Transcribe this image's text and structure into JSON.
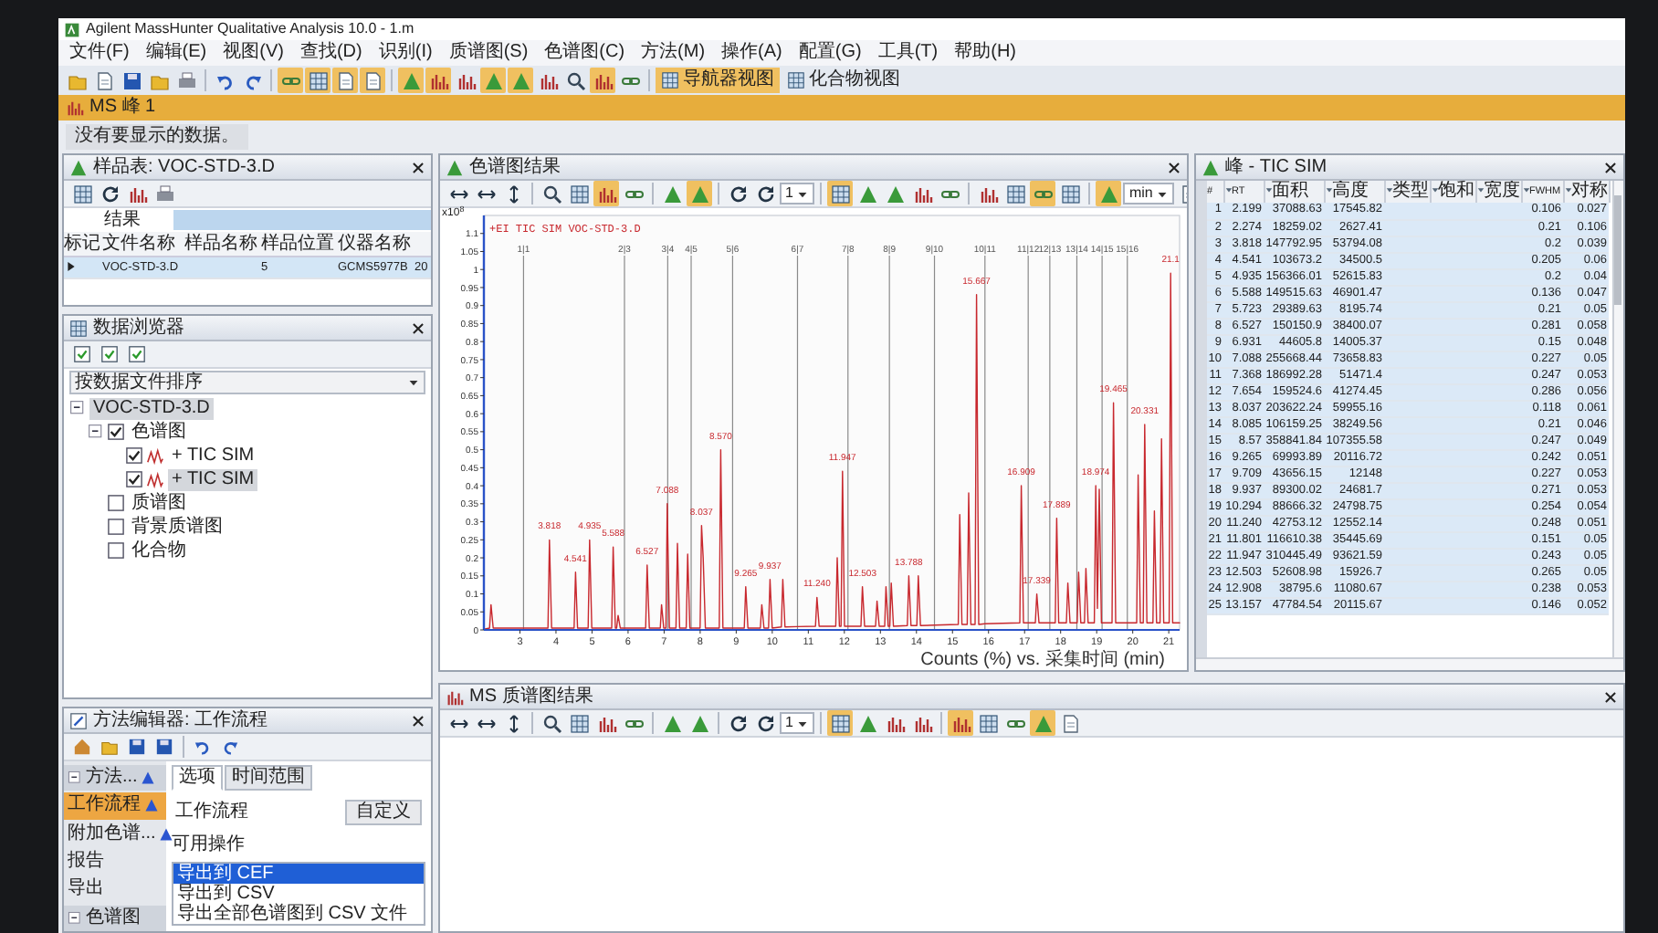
{
  "window": {
    "title": "Agilent MassHunter Qualitative Analysis 10.0 - 1.m"
  },
  "menu": [
    "文件(F)",
    "编辑(E)",
    "视图(V)",
    "查找(D)",
    "识别(I)",
    "质谱图(S)",
    "色谱图(C)",
    "方法(M)",
    "操作(A)",
    "配置(G)",
    "工具(T)",
    "帮助(H)"
  ],
  "toolbar": {
    "groups": [
      [
        {
          "kind": "folder",
          "pressed": false
        },
        {
          "kind": "doc",
          "pressed": false
        },
        {
          "kind": "save",
          "pressed": false
        },
        {
          "kind": "folder",
          "pressed": false
        },
        {
          "kind": "print",
          "pressed": false
        }
      ],
      [
        {
          "kind": "undo",
          "pressed": false
        },
        {
          "kind": "redo",
          "pressed": false
        }
      ],
      [
        {
          "kind": "link",
          "pressed": true
        },
        {
          "kind": "grid",
          "pressed": true
        },
        {
          "kind": "doc",
          "pressed": true
        },
        {
          "kind": "doc",
          "pressed": true
        }
      ],
      [
        {
          "kind": "peak",
          "pressed": true
        },
        {
          "kind": "bars",
          "pressed": true
        },
        {
          "kind": "bars",
          "pressed": false
        },
        {
          "kind": "peak",
          "pressed": true
        },
        {
          "kind": "peak",
          "pressed": true
        },
        {
          "kind": "bars",
          "pressed": false
        },
        {
          "kind": "zoom",
          "pressed": false
        },
        {
          "kind": "bars",
          "pressed": true
        },
        {
          "kind": "link",
          "pressed": false
        }
      ]
    ],
    "views": [
      {
        "label": "导航器视图",
        "selected": true
      },
      {
        "label": "化合物视图",
        "selected": false
      }
    ]
  },
  "document_tab": {
    "label": "MS 峰 1"
  },
  "notice": "没有要显示的数据。",
  "sample_table": {
    "title": "样品表: VOC-STD-3.D",
    "group": "结果",
    "columns": [
      "标记",
      "文件名称",
      "样品名称",
      "样品位置",
      "仪器名称"
    ],
    "rows": [
      {
        "cells": [
          null,
          "VOC-STD-3.D",
          null,
          "5",
          "GCMS5977B",
          "20"
        ],
        "selected": true
      }
    ]
  },
  "data_browser": {
    "title": "数据浏览器",
    "sort": "按数据文件排序",
    "tree": [
      {
        "label": "VOC-STD-3.D",
        "expanded": true,
        "selected": true,
        "children": [
          {
            "label": "色谱图",
            "checked": true,
            "expanded": true,
            "selected": false,
            "children": [
              {
                "label": "+ TIC SIM",
                "kind": "signal",
                "checked": true,
                "selected": false
              },
              {
                "label": "+ TIC SIM",
                "kind": "signal",
                "checked": true,
                "selected": true
              }
            ]
          },
          {
            "label": "质谱图",
            "checked": false,
            "selected": false
          },
          {
            "label": "背景质谱图",
            "checked": false,
            "selected": false
          },
          {
            "label": "化合物",
            "checked": false,
            "selected": false
          }
        ]
      }
    ]
  },
  "method_editor": {
    "title": "方法编辑器: 工作流程",
    "nav": [
      {
        "label": "方法...",
        "kind": "group",
        "warning": true,
        "selected": false
      },
      {
        "label": "工作流程",
        "kind": "item",
        "warning": true,
        "selected": true
      },
      {
        "label": "附加色谱...",
        "kind": "item",
        "warning": true,
        "selected": false
      },
      {
        "label": "报告",
        "kind": "item",
        "warning": false,
        "selected": false
      },
      {
        "label": "导出",
        "kind": "item",
        "warning": false,
        "selected": false
      },
      {
        "label": "色谱图",
        "kind": "group",
        "warning": false,
        "selected": false
      }
    ],
    "tabs": [
      {
        "label": "选项",
        "selected": true
      },
      {
        "label": "时间范围",
        "selected": false
      }
    ],
    "field": {
      "label": "工作流程",
      "value": "自定义"
    },
    "actions": {
      "label": "可用操作",
      "items": [
        {
          "label": "导出到 CEF",
          "selected": true
        },
        {
          "label": "导出到 CSV",
          "selected": false
        },
        {
          "label": "导出全部色谱图到 CSV 文件",
          "selected": false
        }
      ]
    }
  },
  "chromatogram": {
    "title": "色谱图结果",
    "toolbar": [
      [
        {
          "kind": "arrows",
          "pressed": false
        },
        {
          "kind": "arrows",
          "pressed": false
        },
        {
          "kind": "varrows",
          "pressed": false
        }
      ],
      [
        {
          "kind": "zoom",
          "pressed": false
        },
        {
          "kind": "grid",
          "pressed": false
        },
        {
          "kind": "bars",
          "pressed": true
        },
        {
          "kind": "link",
          "pressed": false
        }
      ],
      [
        {
          "kind": "peak",
          "pressed": false
        },
        {
          "kind": "peak",
          "pressed": true
        }
      ],
      [
        {
          "kind": "rotate",
          "pressed": false
        },
        {
          "kind": "rotate",
          "pressed": false
        },
        {
          "kind": "dropdown",
          "value": "1"
        }
      ],
      [
        {
          "kind": "grid",
          "pressed": true
        },
        {
          "kind": "peak",
          "pressed": false
        },
        {
          "kind": "peak",
          "pressed": false
        },
        {
          "kind": "bars",
          "pressed": false
        },
        {
          "kind": "link",
          "pressed": false
        }
      ],
      [
        {
          "kind": "bars",
          "pressed": false
        },
        {
          "kind": "grid",
          "pressed": false
        },
        {
          "kind": "link",
          "pressed": true
        },
        {
          "kind": "grid",
          "pressed": false
        }
      ],
      [
        {
          "kind": "peak",
          "pressed": true
        },
        {
          "kind": "dropdown",
          "value": "min"
        },
        {
          "kind": "doc",
          "pressed": false
        }
      ]
    ],
    "chart_data": {
      "type": "line",
      "title": "+EI TIC SIM VOC-STD-3.D",
      "xlabel": "Counts (%) vs. 采集时间 (min)",
      "ylabel": "x10$^{8}$",
      "x": [
        2.0,
        2.159,
        2.199,
        2.259,
        3.1,
        3.778,
        3.818,
        3.878,
        4.501,
        4.541,
        4.601,
        4.895,
        4.935,
        4.995,
        5.548,
        5.588,
        5.648,
        5.683,
        5.723,
        5.783,
        5.9,
        6.487,
        6.527,
        6.587,
        6.891,
        6.931,
        6.991,
        7.048,
        7.088,
        7.148,
        7.328,
        7.368,
        7.428,
        7.614,
        7.654,
        7.714,
        7.75,
        7.997,
        8.037,
        8.085,
        8.145,
        8.53,
        8.57,
        8.63,
        8.9,
        9.225,
        9.265,
        9.325,
        9.669,
        9.709,
        9.769,
        9.897,
        9.937,
        9.997,
        10.254,
        10.294,
        10.354,
        10.7,
        11.2,
        11.24,
        11.3,
        11.761,
        11.801,
        11.861,
        11.907,
        11.947,
        12.007,
        12.1,
        12.463,
        12.503,
        12.563,
        12.868,
        12.908,
        12.968,
        13.117,
        13.157,
        13.217,
        13.26,
        13.3,
        13.36,
        13.748,
        13.788,
        13.848,
        14.01,
        14.05,
        14.11,
        14.5,
        15.16,
        15.2,
        15.26,
        15.41,
        15.45,
        15.51,
        15.627,
        15.667,
        15.727,
        15.9,
        16.869,
        16.909,
        16.969,
        17.1,
        17.299,
        17.339,
        17.399,
        17.7,
        17.849,
        17.889,
        17.949,
        18.16,
        18.2,
        18.26,
        18.46,
        18.5,
        18.56,
        18.66,
        18.7,
        18.76,
        18.934,
        18.974,
        19.02,
        19.07,
        19.13,
        19.425,
        19.465,
        19.525,
        19.85,
        20.11,
        20.15,
        20.21,
        20.291,
        20.331,
        20.391,
        20.56,
        20.6,
        20.66,
        20.76,
        20.8,
        20.86,
        21.01,
        21.05,
        21.11,
        21.3
      ],
      "series": [
        {
          "color": "#c8282e",
          "values": [
            0.002,
            0.005,
            0.07,
            0.005,
            0.005,
            0.005,
            0.25,
            0.005,
            0.005,
            0.16,
            0.005,
            0.005,
            0.25,
            0.005,
            0.005,
            0.23,
            0.005,
            0.005,
            0.04,
            0.005,
            0.005,
            0.005,
            0.18,
            0.005,
            0.005,
            0.07,
            0.005,
            0.005,
            0.35,
            0.005,
            0.005,
            0.24,
            0.005,
            0.005,
            0.21,
            0.005,
            0.005,
            0.005,
            0.29,
            0.2,
            0.005,
            0.005,
            0.5,
            0.005,
            0.005,
            0.005,
            0.12,
            0.005,
            0.005,
            0.07,
            0.005,
            0.005,
            0.14,
            0.005,
            0.008,
            0.14,
            0.008,
            0.009,
            0.01,
            0.09,
            0.01,
            0.01,
            0.2,
            0.01,
            0.01,
            0.44,
            0.01,
            0.01,
            0.01,
            0.12,
            0.01,
            0.01,
            0.08,
            0.01,
            0.01,
            0.12,
            0.01,
            0.01,
            0.13,
            0.01,
            0.012,
            0.15,
            0.012,
            0.012,
            0.15,
            0.012,
            0.013,
            0.015,
            0.32,
            0.015,
            0.015,
            0.38,
            0.015,
            0.015,
            0.93,
            0.015,
            0.017,
            0.02,
            0.4,
            0.02,
            0.02,
            0.02,
            0.1,
            0.02,
            0.02,
            0.02,
            0.31,
            0.02,
            0.02,
            0.13,
            0.02,
            0.02,
            0.16,
            0.02,
            0.02,
            0.17,
            0.02,
            0.02,
            0.4,
            0.06,
            0.39,
            0.02,
            0.02,
            0.63,
            0.02,
            0.02,
            0.02,
            0.43,
            0.02,
            0.02,
            0.57,
            0.02,
            0.02,
            0.33,
            0.02,
            0.02,
            0.53,
            0.02,
            0.02,
            0.99,
            0.02,
            0.02
          ]
        }
      ],
      "xlim": [
        2,
        21.3
      ],
      "ylim": [
        0,
        1.15
      ],
      "xticks": [
        3,
        4,
        5,
        6,
        7,
        8,
        9,
        10,
        11,
        12,
        13,
        14,
        15,
        16,
        17,
        18,
        19,
        20,
        21
      ],
      "yticks": [
        0,
        0.05,
        0.1,
        0.15,
        0.2,
        0.25,
        0.3,
        0.35,
        0.4,
        0.45,
        0.5,
        0.55,
        0.6,
        0.65,
        0.7,
        0.75,
        0.8,
        0.85,
        0.9,
        0.95,
        1,
        1.05,
        1.1
      ],
      "annotations": [
        {
          "x": 3.1,
          "text": "1|1"
        },
        {
          "x": 5.9,
          "text": "2|3"
        },
        {
          "x": 7.1,
          "text": "3|4"
        },
        {
          "x": 7.75,
          "text": "4|5"
        },
        {
          "x": 8.9,
          "text": "5|6"
        },
        {
          "x": 10.7,
          "text": "6|7"
        },
        {
          "x": 12.1,
          "text": "7|8"
        },
        {
          "x": 13.25,
          "text": "8|9"
        },
        {
          "x": 14.5,
          "text": "9|10"
        },
        {
          "x": 15.9,
          "text": "10|11"
        },
        {
          "x": 17.1,
          "text": "11|12"
        },
        {
          "x": 17.7,
          "text": "12|13"
        },
        {
          "x": 18.45,
          "text": "13|14"
        },
        {
          "x": 19.15,
          "text": "14|15"
        },
        {
          "x": 19.85,
          "text": "15|16"
        },
        {
          "x": 3.818,
          "y": 0.25,
          "text": "3.818"
        },
        {
          "x": 4.541,
          "y": 0.16,
          "text": "4.541"
        },
        {
          "x": 4.935,
          "y": 0.25,
          "text": "4.935"
        },
        {
          "x": 5.588,
          "y": 0.23,
          "text": "5.588"
        },
        {
          "x": 6.527,
          "y": 0.18,
          "text": "6.527"
        },
        {
          "x": 7.088,
          "y": 0.35,
          "text": "7.088"
        },
        {
          "x": 8.037,
          "y": 0.29,
          "text": "8.037"
        },
        {
          "x": 8.57,
          "y": 0.5,
          "text": "8.570"
        },
        {
          "x": 9.265,
          "y": 0.12,
          "text": "9.265"
        },
        {
          "x": 9.937,
          "y": 0.14,
          "text": "9.937"
        },
        {
          "x": 11.24,
          "y": 0.09,
          "text": "11.240"
        },
        {
          "x": 11.947,
          "y": 0.44,
          "text": "11.947"
        },
        {
          "x": 12.503,
          "y": 0.12,
          "text": "12.503"
        },
        {
          "x": 13.788,
          "y": 0.15,
          "text": "13.788"
        },
        {
          "x": 15.667,
          "y": 0.93,
          "text": "15.667"
        },
        {
          "x": 16.909,
          "y": 0.4,
          "text": "16.909"
        },
        {
          "x": 17.339,
          "y": 0.1,
          "text": "17.339"
        },
        {
          "x": 17.889,
          "y": 0.31,
          "text": "17.889"
        },
        {
          "x": 18.974,
          "y": 0.4,
          "text": "18.974"
        },
        {
          "x": 19.465,
          "y": 0.63,
          "text": "19.465"
        },
        {
          "x": 20.331,
          "y": 0.57,
          "text": "20.331"
        },
        {
          "x": 21.05,
          "y": 0.99,
          "text": "21.1"
        }
      ]
    }
  },
  "peaks": {
    "title": "峰 - TIC SIM",
    "columns": [
      "#",
      "RT",
      "面积",
      "高度",
      "类型",
      "饱和",
      "宽度",
      "FWHM",
      "对称"
    ],
    "rows": [
      {
        "cells": [
          "1",
          "2.199",
          "37088.63",
          "17545.82",
          null,
          null,
          null,
          "0.106",
          "0.027"
        ],
        "selected": true
      },
      {
        "cells": [
          "2",
          "2.274",
          "18259.02",
          "2627.41",
          null,
          null,
          null,
          "0.21",
          "0.106"
        ],
        "selected": true
      },
      {
        "cells": [
          "3",
          "3.818",
          "147792.95",
          "53794.08",
          null,
          null,
          null,
          "0.2",
          "0.039"
        ],
        "selected": true
      },
      {
        "cells": [
          "4",
          "4.541",
          "103673.2",
          "34500.5",
          null,
          null,
          null,
          "0.205",
          "0.06"
        ],
        "selected": true
      },
      {
        "cells": [
          "5",
          "4.935",
          "156366.01",
          "52615.83",
          null,
          null,
          null,
          "0.2",
          "0.04"
        ],
        "selected": true
      },
      {
        "cells": [
          "6",
          "5.588",
          "149515.63",
          "46901.47",
          null,
          null,
          null,
          "0.136",
          "0.047"
        ],
        "selected": true
      },
      {
        "cells": [
          "7",
          "5.723",
          "29389.63",
          "8195.74",
          null,
          null,
          null,
          "0.21",
          "0.05"
        ],
        "selected": true
      },
      {
        "cells": [
          "8",
          "6.527",
          "150150.9",
          "38400.07",
          null,
          null,
          null,
          "0.281",
          "0.058"
        ],
        "selected": true
      },
      {
        "cells": [
          "9",
          "6.931",
          "44605.8",
          "14005.37",
          null,
          null,
          null,
          "0.15",
          "0.048"
        ],
        "selected": true
      },
      {
        "cells": [
          "10",
          "7.088",
          "255668.44",
          "73658.83",
          null,
          null,
          null,
          "0.227",
          "0.05"
        ],
        "selected": true
      },
      {
        "cells": [
          "11",
          "7.368",
          "186992.28",
          "51471.4",
          null,
          null,
          null,
          "0.247",
          "0.053"
        ],
        "selected": true
      },
      {
        "cells": [
          "12",
          "7.654",
          "159524.6",
          "41274.45",
          null,
          null,
          null,
          "0.286",
          "0.056"
        ],
        "selected": true
      },
      {
        "cells": [
          "13",
          "8.037",
          "203622.24",
          "59955.16",
          null,
          null,
          null,
          "0.118",
          "0.061"
        ],
        "selected": true
      },
      {
        "cells": [
          "14",
          "8.085",
          "106159.25",
          "38249.56",
          null,
          null,
          null,
          "0.21",
          "0.046"
        ],
        "selected": true
      },
      {
        "cells": [
          "15",
          "8.57",
          "358841.84",
          "107355.58",
          null,
          null,
          null,
          "0.247",
          "0.049"
        ],
        "selected": true
      },
      {
        "cells": [
          "16",
          "9.265",
          "69993.89",
          "20116.72",
          null,
          null,
          null,
          "0.242",
          "0.051"
        ],
        "selected": true
      },
      {
        "cells": [
          "17",
          "9.709",
          "43656.15",
          "12148",
          null,
          null,
          null,
          "0.227",
          "0.053"
        ],
        "selected": true
      },
      {
        "cells": [
          "18",
          "9.937",
          "89300.02",
          "24681.7",
          null,
          null,
          null,
          "0.271",
          "0.053"
        ],
        "selected": true
      },
      {
        "cells": [
          "19",
          "10.294",
          "88666.32",
          "24798.75",
          null,
          null,
          null,
          "0.254",
          "0.054"
        ],
        "selected": true
      },
      {
        "cells": [
          "20",
          "11.240",
          "42753.12",
          "12552.14",
          null,
          null,
          null,
          "0.248",
          "0.051"
        ],
        "selected": true
      },
      {
        "cells": [
          "21",
          "11.801",
          "116610.38",
          "35445.69",
          null,
          null,
          null,
          "0.151",
          "0.05"
        ],
        "selected": true
      },
      {
        "cells": [
          "22",
          "11.947",
          "310445.49",
          "93621.59",
          null,
          null,
          null,
          "0.243",
          "0.05"
        ],
        "selected": true
      },
      {
        "cells": [
          "23",
          "12.503",
          "52608.98",
          "15926.7",
          null,
          null,
          null,
          "0.265",
          "0.05"
        ],
        "selected": true
      },
      {
        "cells": [
          "24",
          "12.908",
          "38795.6",
          "11080.67",
          null,
          null,
          null,
          "0.238",
          "0.053"
        ],
        "selected": true
      },
      {
        "cells": [
          "25",
          "13.157",
          "47784.54",
          "20115.67",
          null,
          null,
          null,
          "0.146",
          "0.052"
        ],
        "selected": true
      }
    ]
  },
  "spectrum": {
    "title": "MS 质谱图结果",
    "toolbar": [
      [
        {
          "kind": "arrows",
          "pressed": false
        },
        {
          "kind": "arrows",
          "pressed": false
        },
        {
          "kind": "varrows",
          "pressed": false
        }
      ],
      [
        {
          "kind": "zoom",
          "pressed": false
        },
        {
          "kind": "grid",
          "pressed": false
        },
        {
          "kind": "bars",
          "pressed": false
        },
        {
          "kind": "link",
          "pressed": false
        }
      ],
      [
        {
          "kind": "peak",
          "pressed": false
        },
        {
          "kind": "peak",
          "pressed": false
        }
      ],
      [
        {
          "kind": "rotate",
          "pressed": false
        },
        {
          "kind": "rotate",
          "pressed": false
        },
        {
          "kind": "dropdown",
          "value": "1"
        }
      ],
      [
        {
          "kind": "grid",
          "pressed": true
        },
        {
          "kind": "peak",
          "pressed": false
        },
        {
          "kind": "bars",
          "pressed": false
        },
        {
          "kind": "bars",
          "pressed": false
        }
      ],
      [
        {
          "kind": "bars",
          "pressed": true
        },
        {
          "kind": "grid",
          "pressed": false
        },
        {
          "kind": "link",
          "pressed": false
        },
        {
          "kind": "peak",
          "pressed": true
        },
        {
          "kind": "doc",
          "pressed": false
        }
      ]
    ]
  }
}
